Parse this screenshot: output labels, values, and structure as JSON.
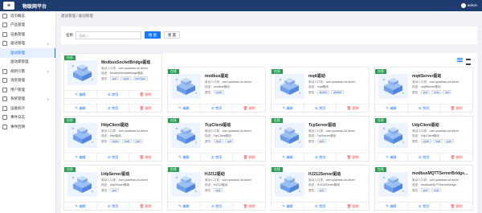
{
  "app": {
    "title": "物联网平台",
    "logo": "iot-logo",
    "user": "admin"
  },
  "sidebar": {
    "items": [
      {
        "label": "首页概览",
        "icon": "home-icon"
      },
      {
        "label": "产品管理",
        "icon": "product-icon"
      },
      {
        "label": "设备管理",
        "icon": "device-icon"
      },
      {
        "label": "驱动管理",
        "icon": "driver-icon",
        "expanded": true,
        "children": [
          {
            "label": "驱动管理",
            "active": true
          },
          {
            "label": "驱动库管理"
          }
        ]
      },
      {
        "label": "规则引擎",
        "icon": "rule-icon",
        "expanded": false
      },
      {
        "label": "消息管理",
        "icon": "message-icon"
      },
      {
        "label": "用户管理",
        "icon": "user-icon"
      },
      {
        "label": "系统管理",
        "icon": "system-icon",
        "expanded": false
      },
      {
        "label": "设备统计",
        "icon": "chart-icon"
      },
      {
        "label": "事件日志",
        "icon": "event-icon"
      },
      {
        "label": "事件回溯",
        "icon": "history-icon"
      }
    ]
  },
  "breadcrumb": "驱动管理 / 驱动管理",
  "search": {
    "label": "名称",
    "placeholder": "请输入",
    "search_button": "搜 索",
    "reset_button": "重 置"
  },
  "toolbar": {
    "add_button": "+ 新增"
  },
  "card_labels": {
    "status": "在线",
    "vendor_prefix": "驱动人口类",
    "desc_prefix": "描述",
    "attr_prefix": "属性",
    "edit": "编辑",
    "disable": "禁用",
    "delete": "删除"
  },
  "colors": {
    "primary": "#1677ff",
    "topbar": "#1e3d6e",
    "online": "#2e9e55",
    "danger": "#ff4d4f"
  },
  "cards": [
    {
      "title": "OpcUA驱动",
      "vendor": "com.yuanbao.iot.driver",
      "desc": "OpcUA驱动",
      "tags": [
        "cycle"
      ]
    },
    {
      "title": "modbus驱动",
      "vendor": "com.yuanbao.iot.driver",
      "desc": "modbus驱动",
      "tags": [
        "cycle"
      ]
    },
    {
      "title": "mqtt驱动",
      "vendor": "com.yuanbao.iot.driver",
      "desc": "mqtt驱动",
      "tags": [
        "broker",
        "clientId"
      ]
    },
    {
      "title": "mqttServer驱动",
      "vendor": "com.yuanbao.iot.driver",
      "desc": "mqttServer驱动",
      "tags": [
        "port",
        "host",
        "ace"
      ]
    },
    {
      "title": "HttpClient驱动",
      "vendor": "com.yuanbao.iot.driver",
      "desc": "Http驱动",
      "tags": [
        "cycle",
        "host",
        "port"
      ]
    },
    {
      "title": "TcpClient驱动",
      "vendor": "com.yuanbao.iot.driver",
      "desc": "TcpClient驱动",
      "tags": [
        "host",
        "port"
      ]
    },
    {
      "title": "TcpServer驱动",
      "vendor": "com.yuanbao.iot.driver",
      "desc": "TcpServer驱动",
      "tags": [
        "port"
      ]
    },
    {
      "title": "UdpClient驱动",
      "vendor": "com.yuanbao.iot.driver",
      "desc": "UdpClient驱动",
      "tags": [
        "cycle",
        "host",
        "port"
      ]
    },
    {
      "title": "UdpServer驱动",
      "vendor": "com.yuanbao.iot.driver",
      "desc": "UdpServer驱动",
      "tags": [
        "port"
      ]
    },
    {
      "title": "HJ212驱动",
      "vendor": "com.yuanbao.iot.driver",
      "desc": "HJ212驱动",
      "tags": [
        "port"
      ]
    },
    {
      "title": "HJ212Server驱动",
      "vendor": "com.yuanbao.iot.driver",
      "desc": "HJ212Server驱动",
      "tags": [
        "port"
      ]
    },
    {
      "title": "modbusMQTTServerBridge...",
      "vendor": "com.yuanbao.iot.driver",
      "desc": "modbusMQTTServerBridge...",
      "tags": [
        "port",
        "host"
      ]
    },
    {
      "title": "ModbusSocketBridge驱动",
      "vendor": "com.yuanbao.iot.driver",
      "desc": "ModbusSocketBridge驱动",
      "tags": [
        "port",
        "cycle",
        "devType"
      ]
    }
  ]
}
